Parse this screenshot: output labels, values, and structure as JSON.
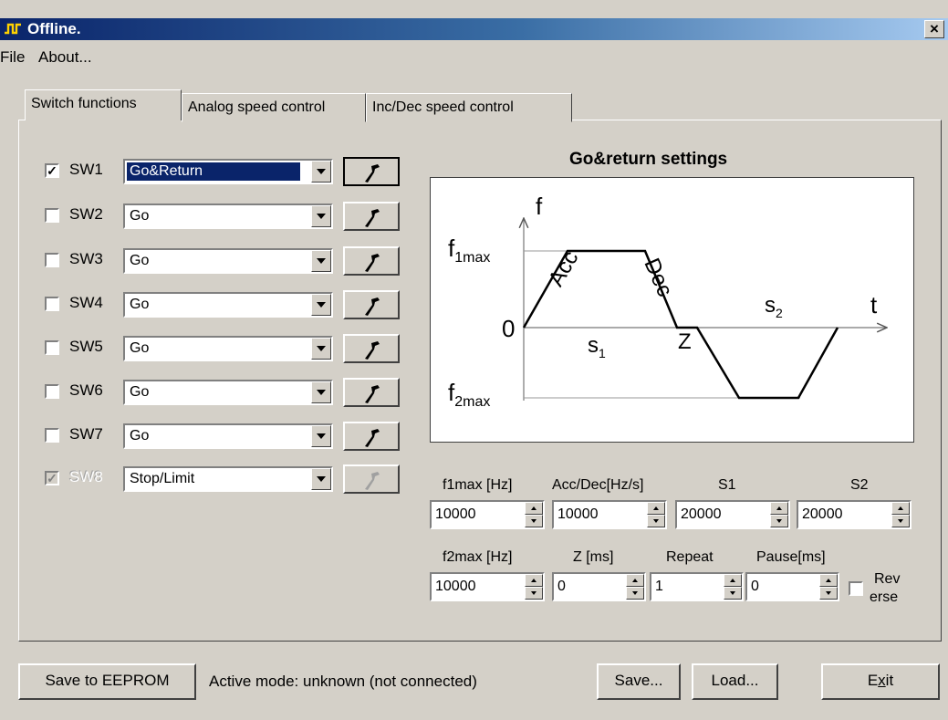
{
  "window": {
    "title": "Offline.",
    "close_glyph": "×"
  },
  "menu": [
    "File",
    "About..."
  ],
  "tabs": [
    "Switch functions",
    "Analog speed control",
    "Inc/Dec speed control"
  ],
  "switches": [
    {
      "label": "SW1",
      "checked": true,
      "mode": "Go&Return"
    },
    {
      "label": "SW2",
      "checked": false,
      "mode": "Go"
    },
    {
      "label": "SW3",
      "checked": false,
      "mode": "Go"
    },
    {
      "label": "SW4",
      "checked": false,
      "mode": "Go"
    },
    {
      "label": "SW5",
      "checked": false,
      "mode": "Go"
    },
    {
      "label": "SW6",
      "checked": false,
      "mode": "Go"
    },
    {
      "label": "SW7",
      "checked": false,
      "mode": "Go"
    },
    {
      "label": "SW8",
      "checked": true,
      "mode": "Stop/Limit"
    }
  ],
  "settings": {
    "title": "Go&return settings",
    "diagram": {
      "f_axis": "f",
      "t_axis": "t",
      "zero": "0",
      "f1": "f",
      "f1_sub": "1max",
      "f2": "f",
      "f2_sub": "2max",
      "acc": "Acc",
      "dec": "Dec",
      "s1": "s",
      "s1_sub": "1",
      "s2": "s",
      "s2_sub": "2",
      "z": "Z"
    },
    "labels": {
      "f1max": "f1max [Hz]",
      "accdec": "Acc/Dec[Hz/s]",
      "s1": "S1",
      "s2": "S2",
      "f2max": "f2max [Hz]",
      "z": "Z [ms]",
      "repeat": "Repeat",
      "pause": "Pause[ms]",
      "reverse_1": "Rev",
      "reverse_2": "erse"
    },
    "values": {
      "f1max": "10000",
      "accdec": "10000",
      "s1": "20000",
      "s2": "20000",
      "f2max": "10000",
      "z": "0",
      "repeat": "1",
      "pause": "0"
    }
  },
  "footer": {
    "save_eeprom": "Save to EEPROM",
    "status": "Active mode: unknown (not connected)",
    "save": "Save...",
    "load": "Load...",
    "exit_pre": "E",
    "exit_mn": "x",
    "exit_post": "it"
  }
}
